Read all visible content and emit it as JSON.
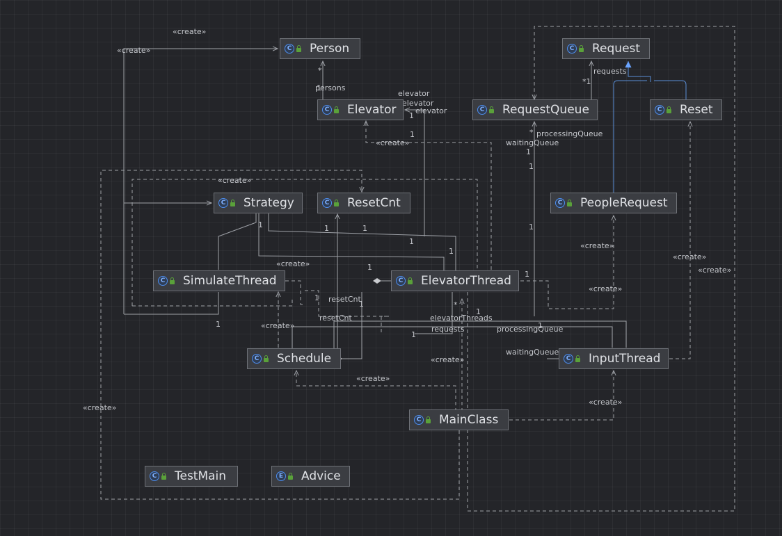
{
  "stereotype": "«create»",
  "nodes": {
    "person": {
      "name": "Person",
      "icon": "C"
    },
    "request": {
      "name": "Request",
      "icon": "C"
    },
    "elevator": {
      "name": "Elevator",
      "icon": "C"
    },
    "request_queue": {
      "name": "RequestQueue",
      "icon": "C"
    },
    "reset": {
      "name": "Reset",
      "icon": "C"
    },
    "strategy": {
      "name": "Strategy",
      "icon": "C"
    },
    "reset_cnt": {
      "name": "ResetCnt",
      "icon": "C"
    },
    "people_request": {
      "name": "PeopleRequest",
      "icon": "C"
    },
    "simulate_thread": {
      "name": "SimulateThread",
      "icon": "C"
    },
    "elevator_thread": {
      "name": "ElevatorThread",
      "icon": "C"
    },
    "schedule": {
      "name": "Schedule",
      "icon": "C"
    },
    "input_thread": {
      "name": "InputThread",
      "icon": "C"
    },
    "main_class": {
      "name": "MainClass",
      "icon": "C"
    },
    "test_main": {
      "name": "TestMain",
      "icon": "C"
    },
    "advice": {
      "name": "Advice",
      "icon": "E"
    }
  },
  "roles": {
    "persons": "persons",
    "requests": "requests",
    "elevator_1": "elevator",
    "elevator_2": "elevator",
    "elevator_3": "elevator",
    "processing_queue": "processingQueue",
    "waiting_queue": "waitingQueue",
    "reset_cnt_1": "resetCnt",
    "reset_cnt_2": "resetCnt",
    "elevator_threads": "elevatorThreads",
    "requests_2": "requests",
    "processing_queue_2": "processingQueue",
    "waiting_queue_2": "waitingQueue"
  },
  "multiplicity": {
    "one": "1",
    "many": "*",
    "many_one": "*1"
  },
  "colors": {
    "background": "#242529",
    "node_fill": "#3b3d42",
    "node_border": "#6f7278",
    "edge": "#9fa2a8",
    "inheritance": "#5a8fd8",
    "class_icon": "#4d8ef0",
    "visibility_lock": "#5aa13a"
  }
}
